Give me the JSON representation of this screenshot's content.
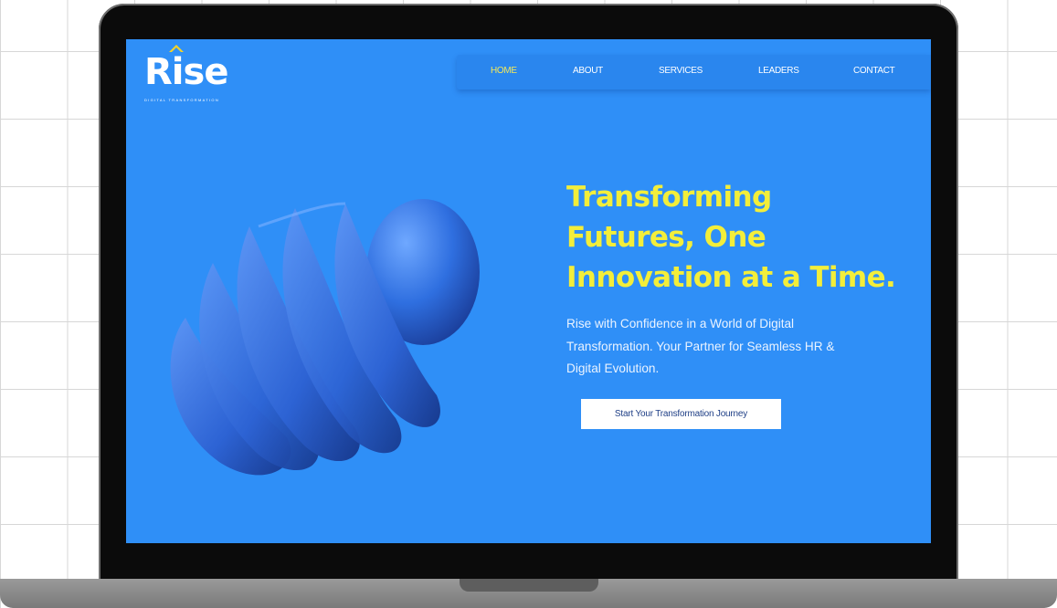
{
  "brand": {
    "logo_text": "Rise",
    "tagline": "DIGITAL TRANSFORMATION"
  },
  "nav": {
    "items": [
      {
        "label": "HOME",
        "active": true
      },
      {
        "label": "ABOUT"
      },
      {
        "label": "SERVICES"
      },
      {
        "label": "LEADERS"
      },
      {
        "label": "CONTACT"
      }
    ]
  },
  "hero": {
    "headline_lines": [
      "Transforming",
      "Futures, One",
      "Innovation at a Time."
    ],
    "subtext_lines": [
      "Rise with Confidence in a World of Digital",
      "Transformation. Your Partner for Seamless HR &",
      "Digital Evolution."
    ],
    "cta_label": "Start Your Transformation Journey"
  },
  "colors": {
    "background": "#2f8ff7",
    "headline": "#f3ee3a",
    "logo_accent": "#f5d327",
    "cta_text": "#1f3f86"
  }
}
